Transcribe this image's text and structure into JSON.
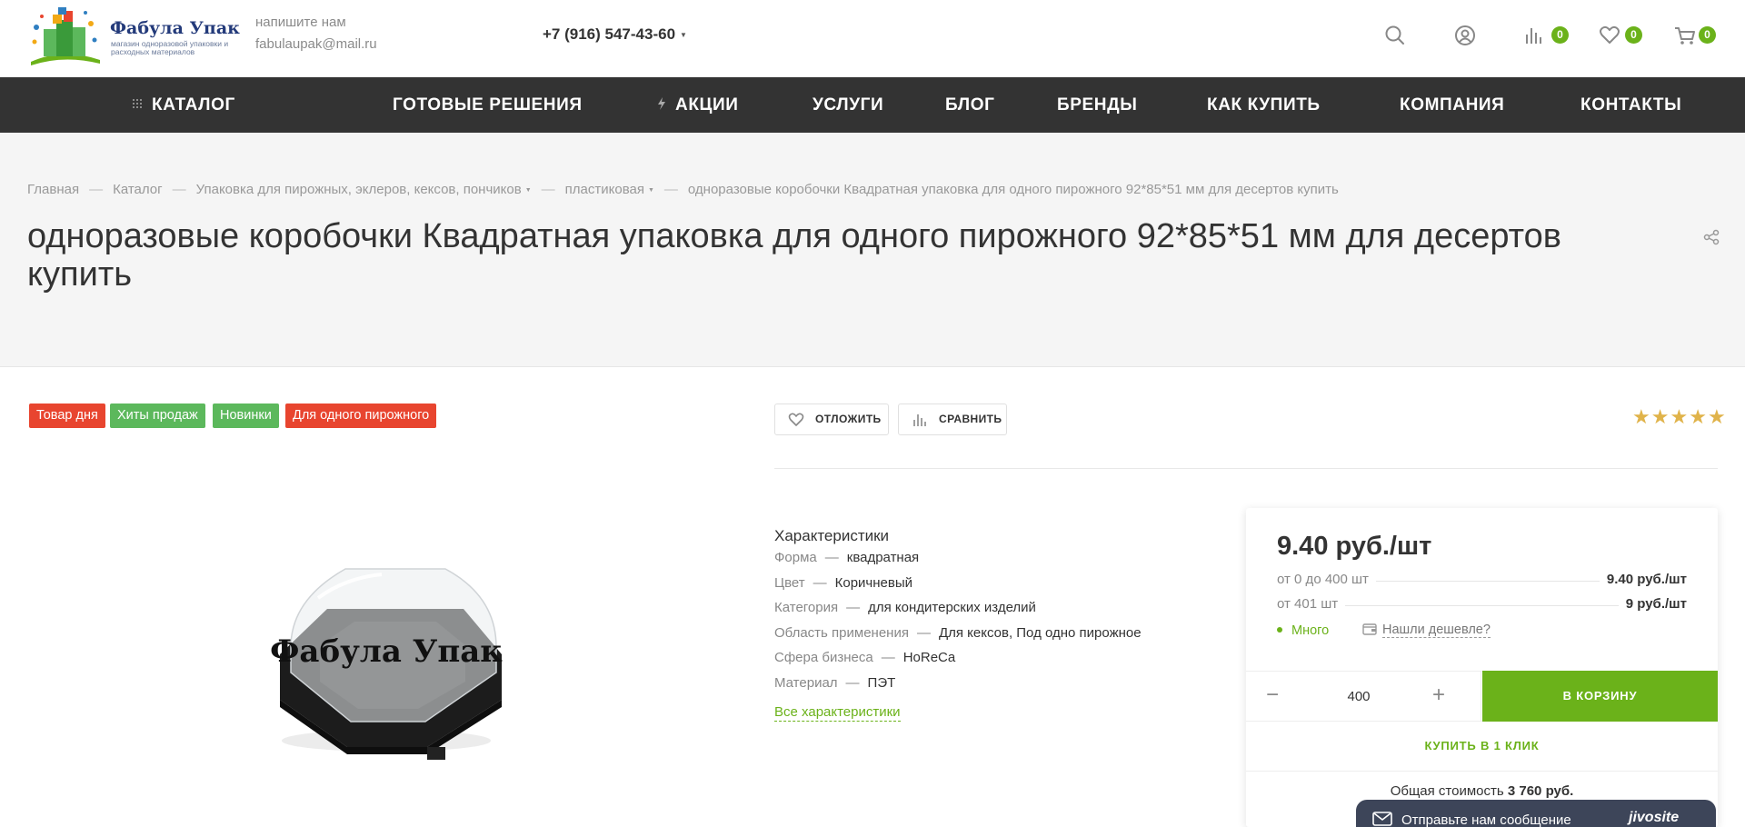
{
  "header": {
    "logo": {
      "title": "Фабула Упак",
      "subtitle": "магазин одноразовой упаковки и расходных материалов"
    },
    "contact": {
      "label": "напишите нам",
      "email": "fabulaupak@mail.ru"
    },
    "phone": "+7 (916) 547-43-60",
    "icons": {
      "search": "search-icon",
      "profile": "user-icon",
      "compare": "compare-icon",
      "favorites": "heart-icon",
      "cart": "cart-icon"
    },
    "compare_count": "0",
    "favorites_count": "0",
    "cart_count": "0"
  },
  "nav": {
    "items": [
      {
        "label": "КАТАЛОГ",
        "icon": "grid-icon"
      },
      {
        "label": "ГОТОВЫЕ РЕШЕНИЯ"
      },
      {
        "label": "АКЦИИ",
        "icon": "lightning-icon"
      },
      {
        "label": "УСЛУГИ"
      },
      {
        "label": "БЛОГ"
      },
      {
        "label": "БРЕНДЫ"
      },
      {
        "label": "КАК КУПИТЬ"
      },
      {
        "label": "КОМПАНИЯ"
      },
      {
        "label": "КОНТАКТЫ"
      }
    ]
  },
  "breadcrumbs": [
    {
      "label": "Главная"
    },
    {
      "label": "Каталог"
    },
    {
      "label": "Упаковка для пирожных, эклеров, кексов, пончиков"
    },
    {
      "label": "пластиковая"
    },
    {
      "label": "одноразовые коробочки Квадратная упаковка для одного пирожного 92*85*51 мм для десертов купить"
    }
  ],
  "title": "одноразовые коробочки Квадратная упаковка для одного пирожного 92*85*51 мм для десертов купить",
  "tags": [
    {
      "label": "Товар дня",
      "color": "#e8452f"
    },
    {
      "label": "Хиты продаж",
      "color": "#5cb85c"
    },
    {
      "label": "Новинки",
      "color": "#5cb85c"
    },
    {
      "label": "Для одного пирожного",
      "color": "#e8452f"
    }
  ],
  "product_image": {
    "watermark": "Фабула Упак"
  },
  "actions": {
    "defer_label": "ОТЛОЖИТЬ",
    "compare_label": "СРАВНИТЬ"
  },
  "rating": {
    "stars": 5,
    "max": 5
  },
  "characteristics": {
    "title": "Характеристики",
    "rows": [
      {
        "key": "Форма",
        "value": "квадратная"
      },
      {
        "key": "Цвет",
        "value": "Коричневый"
      },
      {
        "key": "Категория",
        "value": "для кондитерских изделий"
      },
      {
        "key": "Область применения",
        "value": "Для кексов, Под одно пирожное"
      },
      {
        "key": "Сфера бизнеса",
        "value": "HoReCa"
      },
      {
        "key": "Материал",
        "value": "ПЭТ"
      }
    ],
    "all_link": "Все характеристики"
  },
  "price": {
    "main": "9.40 руб./шт",
    "ranges": [
      {
        "label": "от 0 до 400 шт",
        "value": "9.40 руб./шт"
      },
      {
        "label": "от 401 шт",
        "value": "9 руб./шт"
      }
    ],
    "stock": "Много",
    "cheaper": "Нашли дешевле?",
    "quantity": "400",
    "minus": "−",
    "plus": "+",
    "cart_button": "В КОРЗИНУ",
    "one_click": "КУПИТЬ В 1 КЛИК",
    "total_label": "Общая стоимость",
    "total_value": "3 760 руб."
  },
  "chat": {
    "text": "Отправьте нам сообщение",
    "brand": "jivosite"
  },
  "colors": {
    "accent": "#6bb21a",
    "nav_bg": "#333333",
    "band_bg": "#f5f5f5",
    "star": "#e0b34a"
  }
}
